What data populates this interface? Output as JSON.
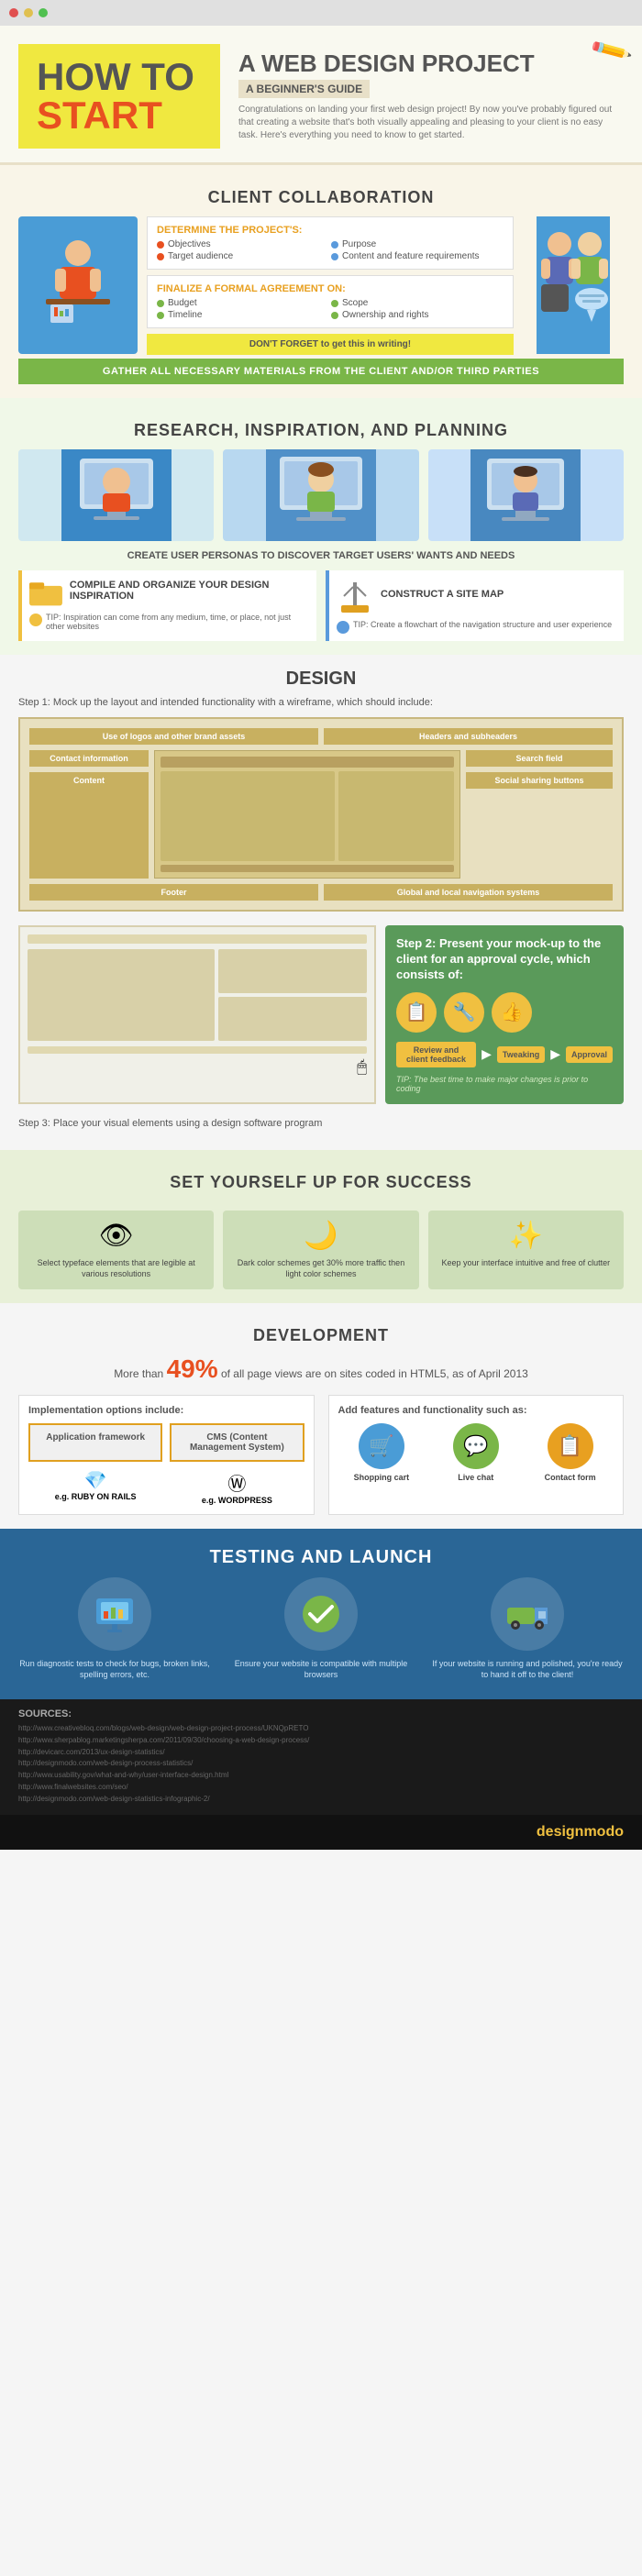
{
  "header": {
    "title_how": "HOW TO",
    "title_start": "START",
    "title_main": "A WEB DESIGN PROJECT",
    "subtitle": "A BEGINNER'S GUIDE",
    "description": "Congratulations on landing your first web design project! By now you've probably figured out that creating a website that's both visually appealing and pleasing to your client is no easy task. Here's everything you need to know to get started."
  },
  "client": {
    "section_title": "CLIENT COLLABORATION",
    "project_title": "DETERMINE THE PROJECT'S:",
    "project_items": [
      {
        "label": "Objectives",
        "color": "#e85020"
      },
      {
        "label": "Purpose",
        "color": "#5a9adc"
      },
      {
        "label": "Target audience",
        "color": "#e85020"
      },
      {
        "label": "Content and feature requirements",
        "color": "#5a9adc"
      }
    ],
    "formal_title": "FINALIZE A FORMAL AGREEMENT ON:",
    "formal_items": [
      {
        "label": "Budget",
        "color": "#7ab648"
      },
      {
        "label": "Scope",
        "color": "#7ab648"
      },
      {
        "label": "Timeline",
        "color": "#7ab648"
      },
      {
        "label": "Ownership and rights",
        "color": "#7ab648"
      }
    ],
    "dont_forget": "DON'T FORGET to get this in writing!",
    "gather_text": "GATHER ALL NECESSARY MATERIALS FROM THE CLIENT AND/OR THIRD PARTIES"
  },
  "research": {
    "section_title": "RESEARCH, INSPIRATION, AND PLANNING",
    "create_text": "CREATE USER PERSONAS TO DISCOVER TARGET USERS' WANTS AND NEEDS",
    "compile_title": "COMPILE AND ORGANIZE YOUR DESIGN INSPIRATION",
    "compile_tip": "TIP: Inspiration can come from any medium, time, or place, not just other websites",
    "construct_title": "CONSTRUCT A SITE MAP",
    "construct_tip": "TIP: Create a flowchart of the navigation structure and user experience"
  },
  "design": {
    "section_title": "DESIGN",
    "step1_label": "Step 1: Mock up the layout and intended functionality with a wireframe, which should include:",
    "wireframe_items_left": [
      "Use of logos and other brand assets",
      "Contact information",
      "Content",
      "Footer"
    ],
    "wireframe_items_right": [
      "Headers and subheaders",
      "Search field",
      "Social sharing buttons",
      "Global and local navigation systems"
    ],
    "step2_title": "Step 2: Present your mock-up to the client for an approval cycle, which consists of:",
    "step2_stages": [
      "Review and client feedback",
      "Tweaking",
      "Approval"
    ],
    "step2_tip": "TIP: The best time to make major changes is prior to coding",
    "step3_label": "Step 3: Place your visual elements using a design software program"
  },
  "setup": {
    "section_title": "SET YOURSELF UP FOR SUCCESS",
    "cards": [
      {
        "icon": "👁",
        "text": "Select typeface elements that are legible at various resolutions"
      },
      {
        "icon": "🌙",
        "text": "Dark color schemes get 30% more traffic then light color schemes"
      },
      {
        "icon": "✨",
        "text": "Keep your interface intuitive and free of clutter"
      }
    ]
  },
  "development": {
    "section_title": "DEVELOPMENT",
    "stat_text": "More than",
    "stat_pct": "49%",
    "stat_suffix": "of all page views are on sites coded in HTML5, as of April 2013",
    "impl_title": "Implementation options include:",
    "impl_options": [
      {
        "label": "Application framework",
        "color": "#e0a020"
      },
      {
        "label": "CMS (Content Management System)",
        "color": "#e0a020"
      }
    ],
    "impl_eg": [
      {
        "label": "e.g. RUBY ON RAILS"
      },
      {
        "label": "e.g. WORDPRESS"
      }
    ],
    "feat_title": "Add features and functionality such as:",
    "feat_items": [
      {
        "label": "Shopping cart",
        "icon": "🛒",
        "bg": "#4a9cd6"
      },
      {
        "label": "Live chat",
        "icon": "💬",
        "bg": "#7ab648"
      },
      {
        "label": "Contact form",
        "icon": "📋",
        "bg": "#e8a020"
      }
    ]
  },
  "testing": {
    "section_title": "TESTING AND LAUNCH",
    "cards": [
      {
        "icon": "📊",
        "text": "Run diagnostic tests to check for bugs, broken links, spelling errors, etc."
      },
      {
        "icon": "✅",
        "text": "Ensure your website is compatible with multiple browsers"
      },
      {
        "icon": "🚚",
        "text": "If your website is running and polished, you're ready to hand it off to the client!"
      }
    ]
  },
  "sources": {
    "title": "SOURCES:",
    "links": [
      "http://www.creativebloq.com/blogs/web-design/web-design-project-process/UKNQpRETO",
      "http://www.sherpablog.marketingsherpa.com/2011/09/30/choosing-a-web-design-process/",
      "http://devicarc.com/2013/ux-design-statistics/",
      "http://designmodo.com/web-design-process-statistics/",
      "http://designmodo.com/web-design-process-statistics/",
      "http://www.usability.gov/what-and-why/user-interface-design.html",
      "http://www.finalwebsites.com/seo/",
      "http://designmodo.com/web-design-statistics-infographic-2/"
    ]
  },
  "brand": {
    "name": "designmodo"
  }
}
